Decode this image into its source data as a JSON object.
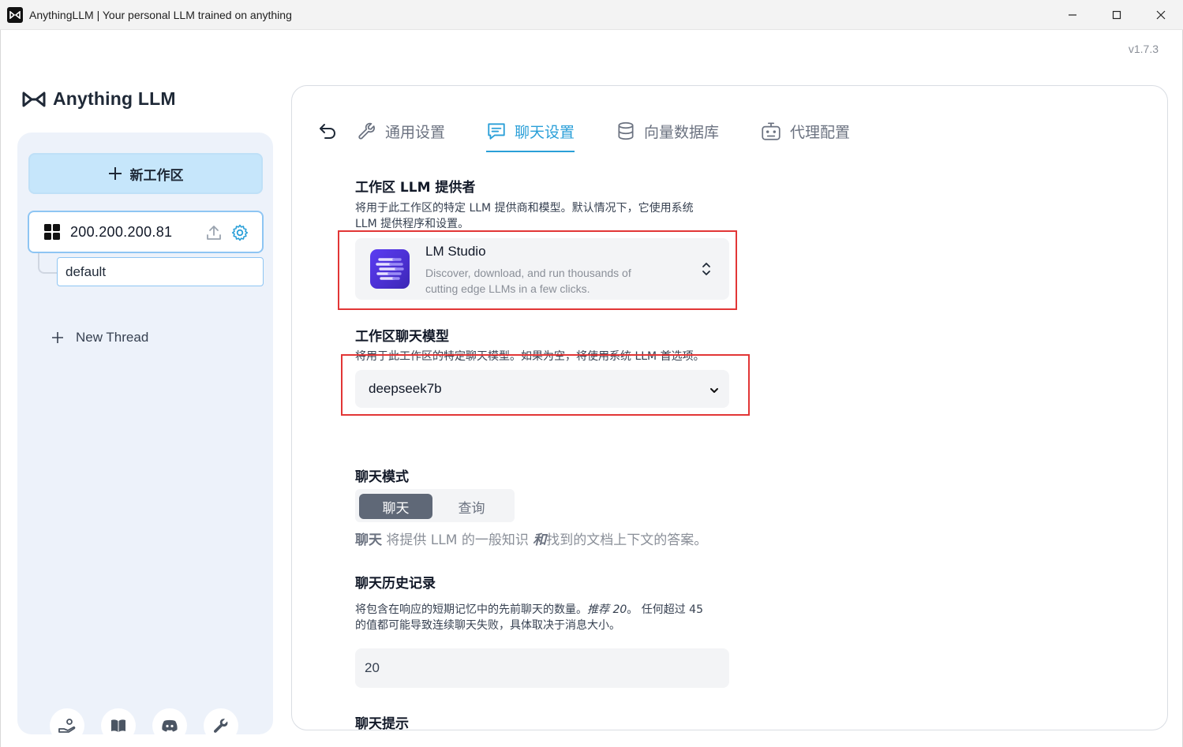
{
  "window": {
    "title": "AnythingLLM | Your personal LLM trained on anything",
    "version": "v1.7.3"
  },
  "brand": {
    "name": "Anything LLM"
  },
  "sidebar": {
    "new_workspace_label": "新工作区",
    "workspace": {
      "name": "200.200.200.81"
    },
    "thread": {
      "name": "default"
    },
    "new_thread_label": "New Thread",
    "footer_icons": [
      "community-hub-icon",
      "docs-book-icon",
      "discord-icon",
      "settings-wrench-icon"
    ]
  },
  "tabs": [
    {
      "label": "通用设置",
      "icon": "wrench-icon",
      "active": false
    },
    {
      "label": "聊天设置",
      "icon": "chat-icon",
      "active": true
    },
    {
      "label": "向量数据库",
      "icon": "database-icon",
      "active": false
    },
    {
      "label": "代理配置",
      "icon": "robot-icon",
      "active": false
    }
  ],
  "llm_provider": {
    "title": "工作区 LLM 提供者",
    "desc_line1": "将用于此工作区的特定 LLM 提供商和模型。默认情况下，它使用系统",
    "desc_line2": "LLM 提供程序和设置。",
    "selected": {
      "name": "LM Studio",
      "desc_line1": "Discover, download, and run thousands of",
      "desc_line2": "cutting edge LLMs in a few clicks."
    }
  },
  "chat_model": {
    "title": "工作区聊天模型",
    "desc": "将用于此工作区的特定聊天模型。如果为空，将使用系统 LLM 首选项。",
    "value": "deepseek7b"
  },
  "chat_mode": {
    "title": "聊天模式",
    "options": [
      "聊天",
      "查询"
    ],
    "selected": "聊天",
    "desc_bold": "聊天",
    "desc_part1": " 将提供 LLM 的一般知识 ",
    "desc_emph": "和",
    "desc_part2": "找到的文档上下文的答案。"
  },
  "chat_history": {
    "title": "聊天历史记录",
    "desc_line1a": "将包含在响应的短期记忆中的先前聊天的数量。",
    "desc_line1b": "推荐 20",
    "desc_line1c": "。 任何超过 45",
    "desc_line2": "的值都可能导致连续聊天失败，具体取决于消息大小。",
    "value": "20"
  },
  "chat_prompt": {
    "title": "聊天提示"
  },
  "colors": {
    "accent": "#2a9fd8",
    "highlight": "#e23636"
  }
}
